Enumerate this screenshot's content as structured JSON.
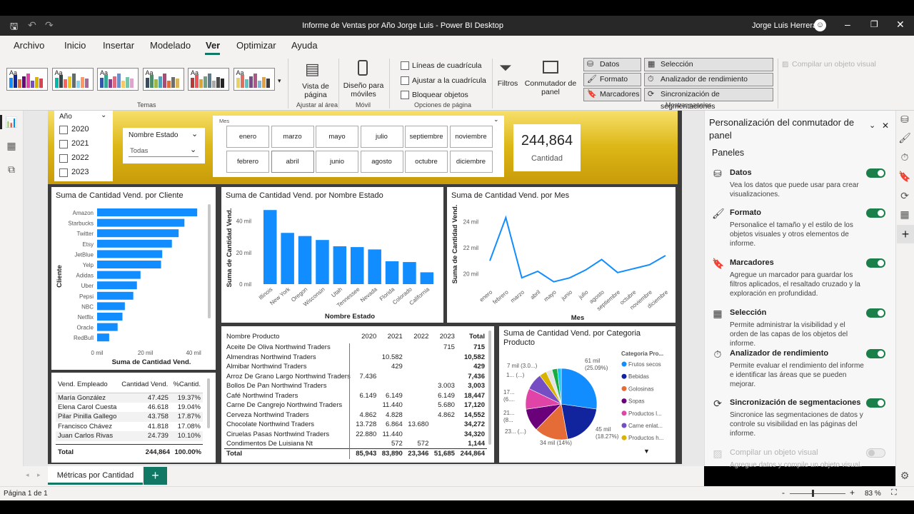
{
  "window": {
    "title": "Informe de Ventas por Año Jorge Luis - Power BI Desktop",
    "user": "Jorge Luis Herrera"
  },
  "ribbon_tabs": [
    "Archivo",
    "Inicio",
    "Insertar",
    "Modelado",
    "Ver",
    "Optimizar",
    "Ayuda"
  ],
  "ribbon": {
    "themes_label": "Temas",
    "theme_sample": "Aa",
    "page_view": "Vista de\npágina",
    "fit_group": "Ajustar al área",
    "mobile_layout": "Diseño para\nmóviles",
    "mobile_group": "Móvil",
    "gridlines": "Líneas de cuadrícula",
    "snap_grid": "Ajustar a la cuadrícula",
    "lock_objects": "Bloquear objetos",
    "page_options_group": "Opciones de página",
    "filters": "Filtros",
    "panel_switcher": "Conmutador de\npanel",
    "data_btn": "Datos",
    "format_btn": "Formato",
    "bookmarks_btn": "Marcadores",
    "selection_btn": "Selección",
    "perf_btn": "Analizador de rendimiento",
    "sync_btn": "Sincronización de segmentaciones",
    "show_panes_group": "Mostrar paneles",
    "build_visual": "Compilar un objeto visual"
  },
  "slicers": {
    "year": {
      "title": "Año",
      "items": [
        "2020",
        "2021",
        "2022",
        "2023"
      ]
    },
    "state": {
      "title": "Nombre Estado",
      "value": "Todas"
    },
    "month": {
      "title": "Mes",
      "items": [
        "enero",
        "marzo",
        "mayo",
        "julio",
        "septiembre",
        "noviembre",
        "febrero",
        "abril",
        "junio",
        "agosto",
        "octubre",
        "diciembre"
      ]
    }
  },
  "card": {
    "value": "244,864",
    "label": "Cantidad"
  },
  "charts": {
    "client": {
      "title": "Suma de Cantidad Vend. por Cliente",
      "ylabel": "Cliente",
      "xlabel": "Suma de Cantidad Vend.",
      "ticks": [
        "0 mil",
        "20 mil",
        "40 mil"
      ]
    },
    "state": {
      "title": "Suma de Cantidad Vend. por Nombre Estado",
      "ylabel": "Suma de Cantidad Vend.",
      "xlabel": "Nombre Estado",
      "ticks": [
        "0 mil",
        "20 mil",
        "40 mil"
      ]
    },
    "month": {
      "title": "Suma de Cantidad Vend. por Mes",
      "ylabel": "Suma de Cantidad Vend.",
      "xlabel": "Mes",
      "ticks": [
        "20 mil",
        "22 mil",
        "24 mil"
      ]
    },
    "category": {
      "title": "Suma de Cantidad Vend. por Categoria Producto",
      "legend_title": "Categoria Pro...",
      "labels": [
        "61 mil\n(25.09%)",
        "45 mil\n(18.27%)",
        "34 mil (14%)",
        "23... (...)",
        "21...\n(8...",
        "17...\n(6....",
        "1... (...)",
        "7 mil (3.0...)"
      ]
    }
  },
  "chart_data": [
    {
      "type": "bar",
      "orientation": "horizontal",
      "title": "Suma de Cantidad Vend. por Cliente",
      "xlabel": "Suma de Cantidad Vend.",
      "ylabel": "Cliente",
      "categories": [
        "Amazon",
        "Starbucks",
        "Twitter",
        "Etsy",
        "JetBlue",
        "Yelp",
        "Adidas",
        "Uber",
        "Pepsi",
        "NBC",
        "Netflix",
        "Oracle",
        "RedBull"
      ],
      "values": [
        41.5,
        36.2,
        33.8,
        31,
        27,
        26.5,
        18,
        16.5,
        15,
        11.5,
        10.5,
        8.5,
        5
      ],
      "xlim": [
        0,
        45
      ]
    },
    {
      "type": "bar",
      "title": "Suma de Cantidad Vend. por Nombre Estado",
      "xlabel": "Nombre Estado",
      "ylabel": "Suma de Cantidad Vend.",
      "categories": [
        "Illinois",
        "New York",
        "Oregon",
        "Wisconsin",
        "Utah",
        "Tennessee",
        "Nevada",
        "Florida",
        "Colorado",
        "California"
      ],
      "values": [
        47,
        32.5,
        30.5,
        28,
        24,
        23.5,
        22,
        14.5,
        14,
        7.5
      ],
      "ylim": [
        0,
        48
      ]
    },
    {
      "type": "line",
      "title": "Suma de Cantidad Vend. por Mes",
      "xlabel": "Mes",
      "ylabel": "Suma de Cantidad Vend.",
      "categories": [
        "enero",
        "febrero",
        "marzo",
        "abril",
        "mayo",
        "junio",
        "julio",
        "agosto",
        "septiembre",
        "octubre",
        "noviembre",
        "diciembre"
      ],
      "values": [
        21,
        24.3,
        19.7,
        20.2,
        19.4,
        19.7,
        20.3,
        21.1,
        20.1,
        20.4,
        20.7,
        21.4
      ],
      "ylim": [
        19,
        25
      ]
    },
    {
      "type": "pie",
      "title": "Suma de Cantidad Vend. por Categoria Producto",
      "categories": [
        "Frutos secos",
        "Bebidas",
        "Golosinas",
        "Sopas",
        "Productos l...",
        "Carne enlat...",
        "Productos h..."
      ],
      "values": [
        25.09,
        18.27,
        14,
        9.5,
        8.7,
        7,
        3
      ],
      "colors": [
        "#118dff",
        "#12239e",
        "#e66c37",
        "#6b007b",
        "#e044a7",
        "#744ec2",
        "#d9b300"
      ]
    }
  ],
  "emp_table": {
    "headers": [
      "Vend. Empleado",
      "Cantidad Vend.",
      "%Cantid."
    ],
    "rows": [
      [
        "María González",
        "47.425",
        "19.37%"
      ],
      [
        "Elena Carol Cuesta",
        "46.618",
        "19.04%"
      ],
      [
        "Pilar Pinilla Gallego",
        "43.758",
        "17.87%"
      ],
      [
        "Francisco Chávez",
        "41.818",
        "17.08%"
      ],
      [
        "Juan Carlos Rivas",
        "24.739",
        "10.10%"
      ]
    ],
    "total": [
      "Total",
      "244,864",
      "100.00%"
    ]
  },
  "prod_table": {
    "headers": [
      "Nombre Producto",
      "2020",
      "2021",
      "2022",
      "2023",
      "Total"
    ],
    "rows": [
      [
        "Aceite De Oliva Northwind Traders",
        "",
        "",
        "",
        "715",
        "715"
      ],
      [
        "Almendras Northwind Traders",
        "",
        "10.582",
        "",
        "",
        "10,582"
      ],
      [
        "Almibar Northwind Traders",
        "",
        "429",
        "",
        "",
        "429"
      ],
      [
        "Arroz De Grano Largo Northwind Traders",
        "7.436",
        "",
        "",
        "",
        "7,436"
      ],
      [
        "Bollos De Pan Northwind Traders",
        "",
        "",
        "",
        "3.003",
        "3,003"
      ],
      [
        "Café Northwind Traders",
        "6.149",
        "6.149",
        "",
        "6.149",
        "18,447"
      ],
      [
        "Carne De Cangrejo Northwind Traders",
        "",
        "11.440",
        "",
        "5.680",
        "17,120"
      ],
      [
        "Cerveza Northwind Traders",
        "4.862",
        "4.828",
        "",
        "4.862",
        "14,552"
      ],
      [
        "Chocolate Northwind Traders",
        "13.728",
        "6.864",
        "13.680",
        "",
        "34,272"
      ],
      [
        "Ciruelas Pasas Northwind Traders",
        "22.880",
        "11.440",
        "",
        "",
        "34,320"
      ],
      [
        "Condimentos De Luisiana Nt",
        "",
        "572",
        "572",
        "",
        "1,144"
      ]
    ],
    "total": [
      "Total",
      "85,943",
      "83,890",
      "23,346",
      "51,685",
      "244,864"
    ]
  },
  "right_pane": {
    "title": "Personalización del conmutador de\npanel",
    "section": "Paneles",
    "items": [
      {
        "name": "Datos",
        "desc": "Vea los datos que puede usar para crear visualizaciones.",
        "on": true
      },
      {
        "name": "Formato",
        "desc": "Personalice el tamaño y el estilo de los objetos visuales y otros elementos de informe.",
        "on": true
      },
      {
        "name": "Marcadores",
        "desc": "Agregue un marcador para guardar los filtros aplicados, el resaltado cruzado y la exploración en profundidad.",
        "on": true
      },
      {
        "name": "Selección",
        "desc": "Permite administrar la visibilidad y el orden de las capas de los objetos del informe.",
        "on": true
      },
      {
        "name": "Analizador de rendimiento",
        "desc": "Permite evaluar el rendimiento del informe e identificar las áreas que se pueden mejorar.",
        "on": true
      },
      {
        "name": "Sincronización de segmentaciones",
        "desc": "Sincronice las segmentaciones de datos y controle su visibilidad en las páginas del informe.",
        "on": true
      },
      {
        "name": "Compilar un objeto visual",
        "desc": "Agregue datos y compile un objeto visual.",
        "on": false
      }
    ]
  },
  "page_tab": "Métricas por Cantidad",
  "status": {
    "page": "Página 1 de 1",
    "zoom": "83 %"
  }
}
